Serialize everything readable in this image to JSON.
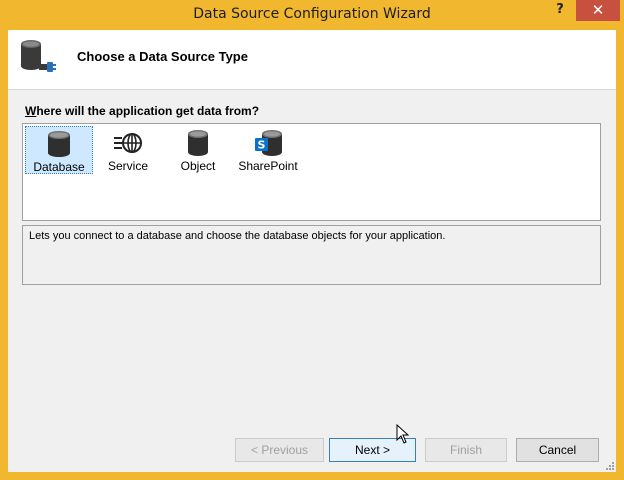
{
  "window": {
    "title": "Data Source Configuration Wizard",
    "help_label": "?",
    "close_label": "✕"
  },
  "header": {
    "title": "Choose a Data Source Type"
  },
  "question": {
    "access_key": "W",
    "rest": "here will the application get data from?"
  },
  "items": [
    {
      "label": "Database",
      "icon": "database-icon",
      "selected": true
    },
    {
      "label": "Service",
      "icon": "service-icon",
      "selected": false
    },
    {
      "label": "Object",
      "icon": "object-icon",
      "selected": false
    },
    {
      "label": "SharePoint",
      "icon": "sharepoint-icon",
      "selected": false
    }
  ],
  "description": "Lets you connect to a database and choose the database objects for your application.",
  "buttons": {
    "previous": "< Previous",
    "next": "Next >",
    "finish": "Finish",
    "cancel": "Cancel"
  },
  "colors": {
    "frame": "#f0b72f",
    "close": "#c7503e",
    "selection": "#cde8ff",
    "accent": "#3c7fb1"
  }
}
